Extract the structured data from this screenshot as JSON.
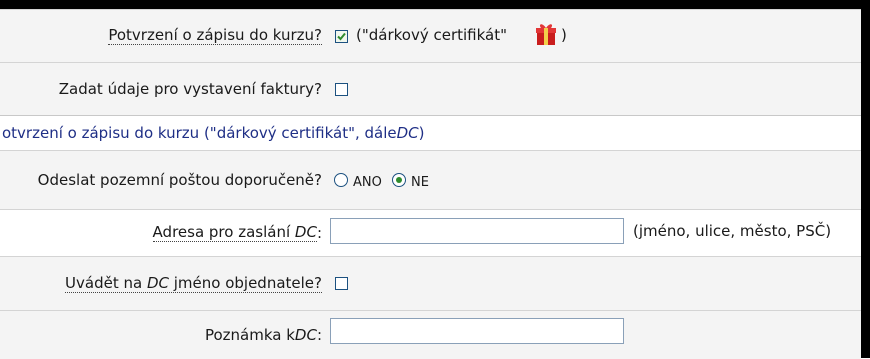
{
  "order_form": {
    "enrollment_confirmation": {
      "label": "Potvrzení o zápisu do kurzu?",
      "checked": true,
      "note": "(\"dárkový certifikát\"",
      "note_close": ")",
      "icon": "gift-icon"
    },
    "invoice": {
      "label": "Zadat údaje pro vystavení faktury?",
      "checked": false
    }
  },
  "dc_section": {
    "title_main": "otvrzení o zápisu do kurzu (\"dárkový certifikát\", dále ",
    "title_abbr": "DC",
    "title_end": ")",
    "post": {
      "label": "Odeslat pozemní poštou doporučeně?",
      "option_yes": "ANO",
      "option_no": "NE",
      "selected": "NE"
    },
    "address": {
      "label_prefix": "Adresa pro zaslání ",
      "label_abbr": "DC",
      "label_colon": ":",
      "value": "",
      "hint": "(jméno, ulice, město, PSČ)"
    },
    "orderer_name": {
      "label_prefix": "Uvádět na ",
      "label_abbr": "DC",
      "label_suffix": " jméno objednatele?",
      "checked": false
    },
    "note": {
      "label_prefix": "Poznámka k ",
      "label_abbr": "DC",
      "label_colon": ":",
      "value": ""
    }
  },
  "colors": {
    "row_bg": "#f4f4f4",
    "section_title": "#1f2f86",
    "control_border": "#1c5180",
    "checked_mark": "#2e8b2e"
  }
}
